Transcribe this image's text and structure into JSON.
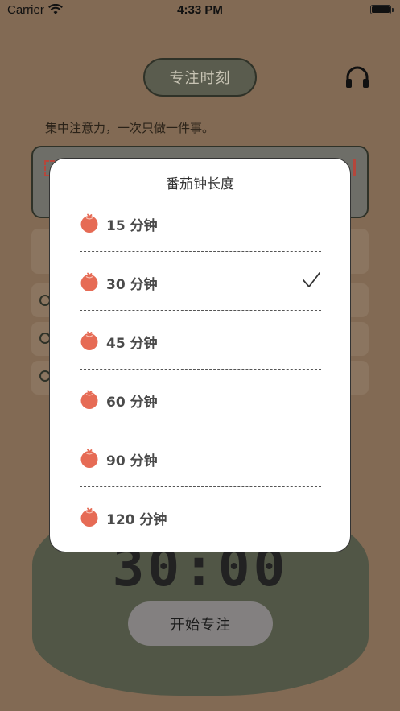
{
  "status_bar": {
    "carrier": "Carrier",
    "time": "4:33 PM"
  },
  "header": {
    "title": "专注时刻",
    "motto": "集中注意力，一次只做一件事。"
  },
  "timer": {
    "display": "30:00",
    "start_label": "开始专注"
  },
  "modal": {
    "title": "番茄钟长度",
    "options": [
      {
        "label": "15 分钟",
        "selected": false
      },
      {
        "label": "30 分钟",
        "selected": true
      },
      {
        "label": "45 分钟",
        "selected": false
      },
      {
        "label": "60 分钟",
        "selected": false
      },
      {
        "label": "90 分钟",
        "selected": false
      },
      {
        "label": "120 分钟",
        "selected": false
      }
    ]
  },
  "colors": {
    "background": "#826a54",
    "accent": "#e66b55",
    "timer_panel": "#515646"
  }
}
